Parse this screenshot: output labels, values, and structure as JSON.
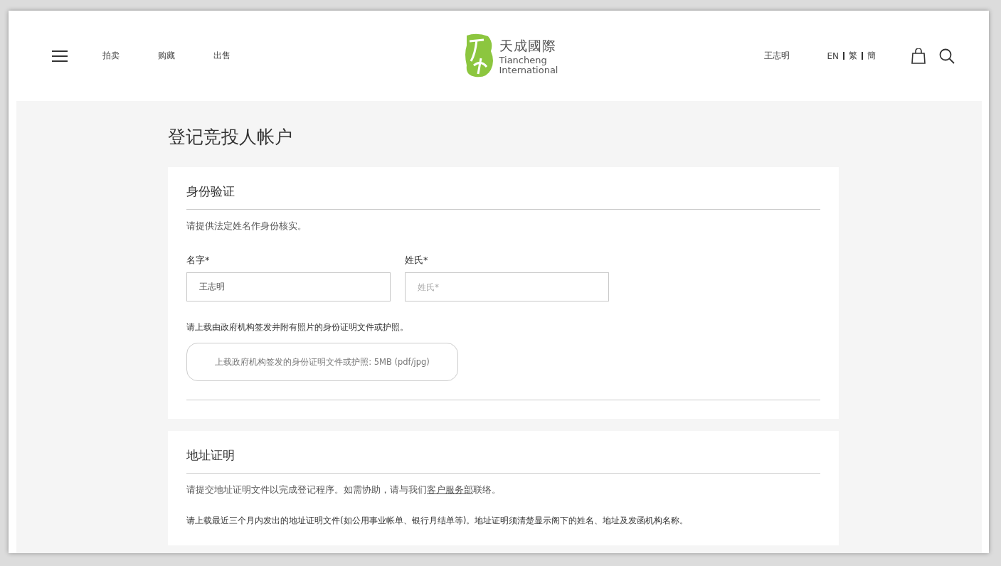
{
  "header": {
    "nav": [
      "拍卖",
      "购藏",
      "出售"
    ],
    "logo": {
      "chinese": "天成國際",
      "english_1": "Tiancheng",
      "english_2": "International"
    },
    "user": "王志明",
    "languages": [
      "EN",
      "繁",
      "簡"
    ]
  },
  "page_title": "登记竞投人帐户",
  "identity": {
    "title": "身份验证",
    "intro": "请提供法定姓名作身份核实。",
    "fields": [
      {
        "label": "名字*",
        "value": "王志明"
      },
      {
        "label": "姓氏*",
        "placeholder": "姓氏*"
      }
    ],
    "upload_note": "请上载由政府机构签发并附有照片的身份证明文件或护照。",
    "upload_button": "上载政府机构签发的身份证明文件或护照: 5MB (pdf/jpg)"
  },
  "address": {
    "title": "地址证明",
    "intro_before": "请提交地址证明文件以完成登记程序。如需协助，请与我们",
    "intro_link": "客户服务部",
    "intro_after": "联络。",
    "upload_note": "请上载最近三个月内发出的地址证明文件(如公用事业帐单、银行月结单等)。地址证明须清楚显示阁下的姓名、地址及发函机构名称。"
  }
}
